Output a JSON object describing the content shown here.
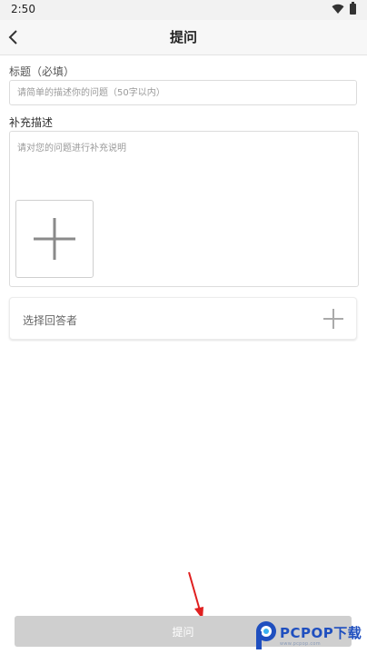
{
  "status_bar": {
    "time": "2:50",
    "icons": [
      "wifi-icon",
      "battery-icon"
    ]
  },
  "header": {
    "title": "提问",
    "back_icon": "chevron-left-icon"
  },
  "form": {
    "title_label": "标题（必填）",
    "title_placeholder": "请简单的描述你的问题（50字以内）",
    "title_value": "",
    "supplement_label": "补充描述",
    "supplement_placeholder": "请对您的问题进行补充说明",
    "add_image_icon": "plus-icon",
    "responder_label": "选择回答者",
    "responder_icon": "plus-icon"
  },
  "footer": {
    "submit_label": "提问"
  },
  "watermark": {
    "brand": "PCPOP下载",
    "subtitle": "www.pcpop.com"
  },
  "colors": {
    "submit_bg": "#cfcfcf",
    "annotation_arrow": "#e02020",
    "brand_blue": "#1f4fbf"
  }
}
